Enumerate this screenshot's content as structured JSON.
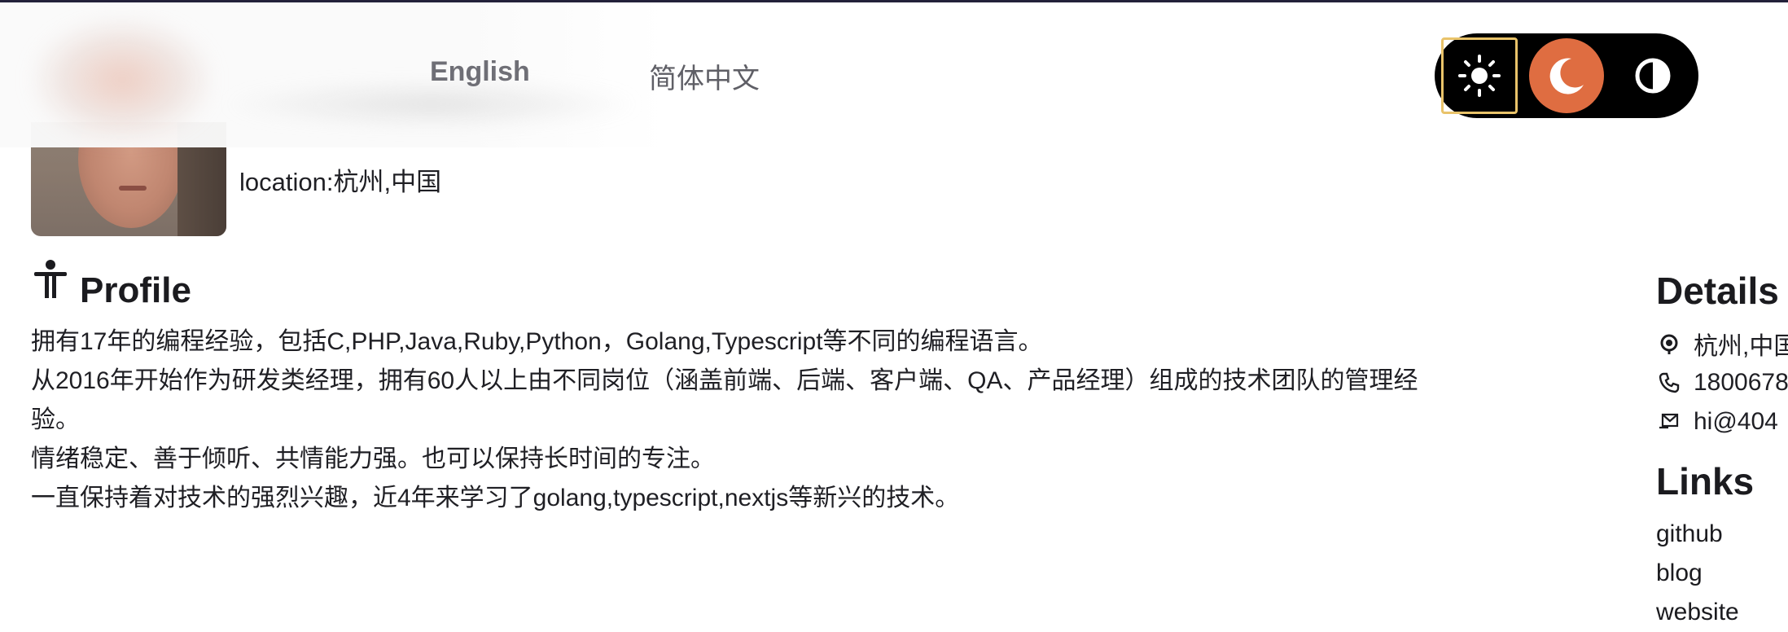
{
  "header": {
    "lang_options": [
      "English",
      "简体中文"
    ]
  },
  "theme": {
    "options": [
      "light-icon",
      "dark-icon",
      "system-icon"
    ],
    "active_color": "#df6d41",
    "focus_color": "#e9c36a"
  },
  "profile": {
    "location_line": "location:杭州,中国",
    "title": "Profile",
    "paragraphs": [
      "拥有17年的编程经验，包括C,PHP,Java,Ruby,Python，Golang,Typescript等不同的编程语言。",
      "从2016年开始作为研发类经理，拥有60人以上由不同岗位（涵盖前端、后端、客户端、QA、产品经理）组成的技术团队的管理经",
      "验。",
      "情绪稳定、善于倾听、共情能力强。也可以保持长时间的专注。",
      "一直保持着对技术的强烈兴趣，近4年来学习了golang,typescript,nextjs等新兴的技术。"
    ]
  },
  "details": {
    "title": "Details",
    "location": "杭州,中国",
    "phone": "1800678",
    "email": "hi@404"
  },
  "links": {
    "title": "Links",
    "items": [
      "github",
      "blog",
      "website"
    ]
  }
}
